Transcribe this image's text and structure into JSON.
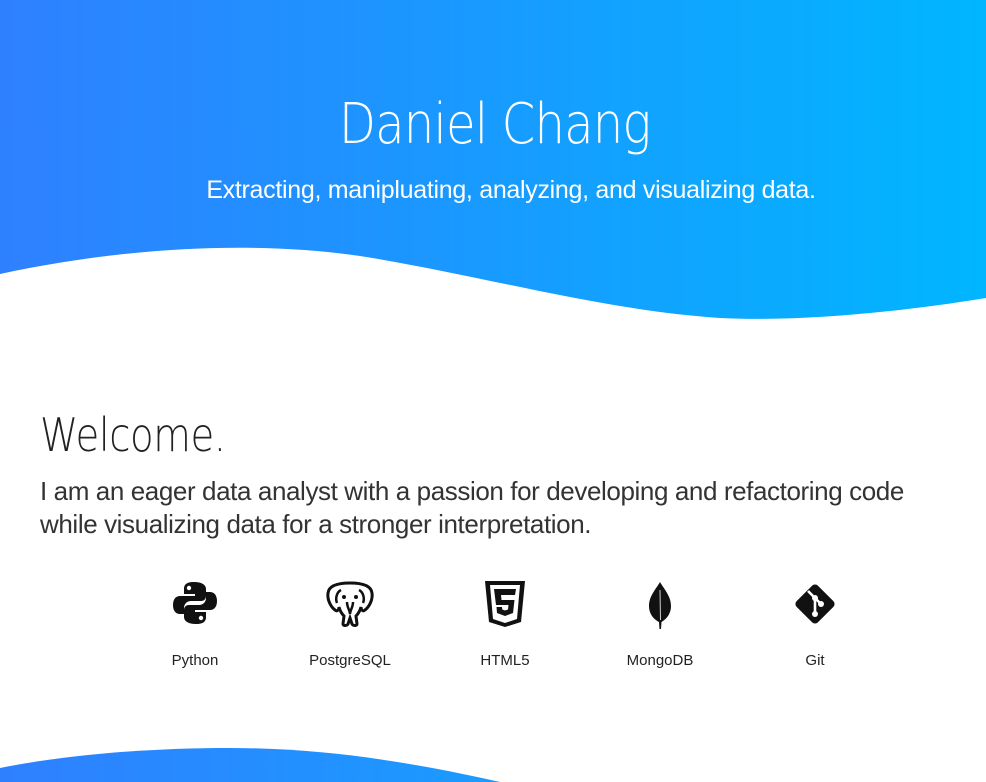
{
  "hero": {
    "title": "Daniel Chang",
    "subtitle": "Extracting, manipluating, analyzing, and visualizing data.",
    "gradient_start": "#2f80ff",
    "gradient_end": "#00b4ff"
  },
  "welcome": {
    "heading": "Welcome.",
    "text": "I am an eager data analyst with a passion for developing and refactoring code while visualizing data for a stronger interpretation."
  },
  "skills": [
    {
      "label": "Python",
      "icon": "python-icon"
    },
    {
      "label": "PostgreSQL",
      "icon": "postgresql-icon"
    },
    {
      "label": "HTML5",
      "icon": "html5-icon"
    },
    {
      "label": "MongoDB",
      "icon": "mongodb-icon"
    },
    {
      "label": "Git",
      "icon": "git-icon"
    }
  ]
}
